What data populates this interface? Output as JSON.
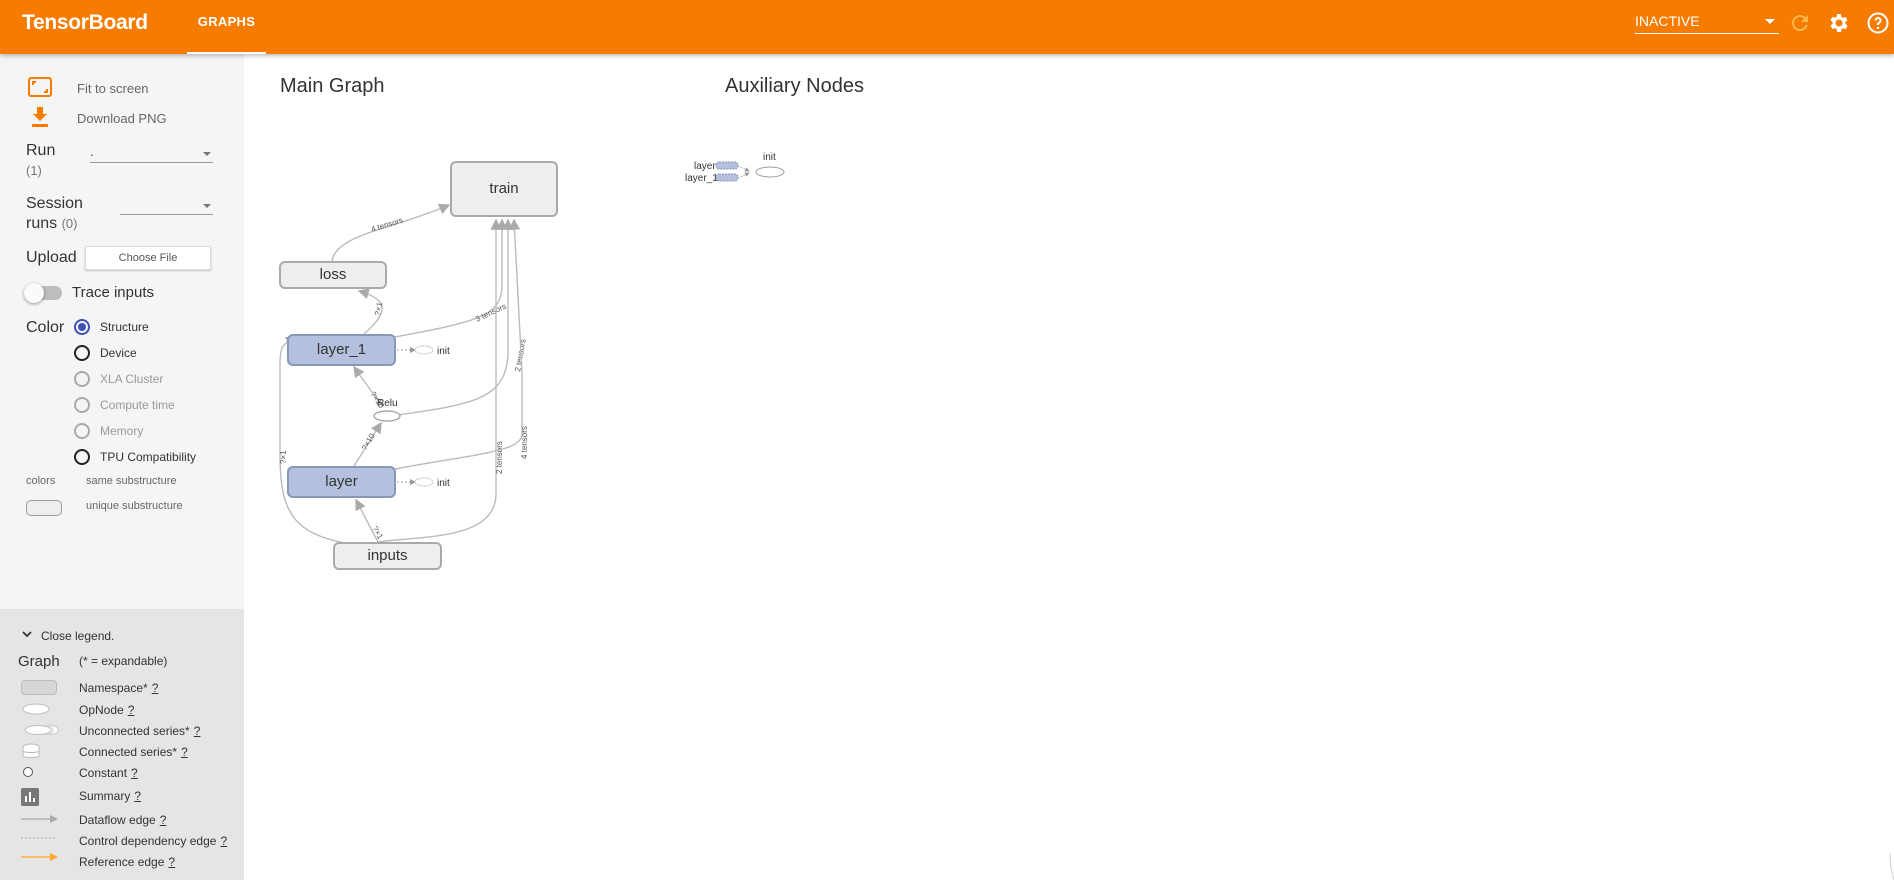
{
  "app": {
    "title": "TensorBoard",
    "tab": "GRAPHS",
    "run_status": "INACTIVE"
  },
  "colors": {
    "accent": "#f57c00",
    "layer_node": "#b4c0de",
    "radio_checked": "#3f51b5"
  },
  "sidebar": {
    "fit_label": "Fit to screen",
    "download_label": "Download PNG",
    "run_label": "Run",
    "run_count": "(1)",
    "run_value": ".",
    "session_label_1": "Session",
    "session_label_2": "runs",
    "session_count": "(0)",
    "upload_label": "Upload",
    "choose_file": "Choose File",
    "trace_label": "Trace inputs",
    "color_label": "Color",
    "color_options": [
      {
        "label": "Structure",
        "checked": true,
        "disabled": false
      },
      {
        "label": "Device",
        "checked": false,
        "disabled": false
      },
      {
        "label": "XLA Cluster",
        "checked": false,
        "disabled": true
      },
      {
        "label": "Compute time",
        "checked": false,
        "disabled": true
      },
      {
        "label": "Memory",
        "checked": false,
        "disabled": true
      },
      {
        "label": "TPU Compatibility",
        "checked": false,
        "disabled": false
      }
    ],
    "colors_label": "colors",
    "same_sub": "same substructure",
    "unique_sub": "unique substructure"
  },
  "legend": {
    "close_label": "Close legend.",
    "graph_label": "Graph",
    "expandable": "(* = expandable)",
    "items": [
      {
        "label": "Namespace*",
        "help": "?"
      },
      {
        "label": "OpNode",
        "help": "?"
      },
      {
        "label": "Unconnected series*",
        "help": "?"
      },
      {
        "label": "Connected series*",
        "help": "?"
      },
      {
        "label": "Constant",
        "help": "?"
      },
      {
        "label": "Summary",
        "help": "?"
      },
      {
        "label": "Dataflow edge",
        "help": "?"
      },
      {
        "label": "Control dependency edge",
        "help": "?"
      },
      {
        "label": "Reference edge",
        "help": "?"
      }
    ]
  },
  "graph": {
    "main_title": "Main Graph",
    "aux_title": "Auxiliary Nodes",
    "nodes": {
      "train": "train",
      "loss": "loss",
      "layer_1": "layer_1",
      "layer": "layer",
      "inputs": "inputs",
      "relu": "Relu",
      "init": "init"
    },
    "edge_labels": {
      "loss_train": "4 tensors",
      "layer1_train": "3 tensors",
      "relu_train": "2 tensors",
      "inputs_train": "2 tensors",
      "layer_train": "4 tensors",
      "layer1_loss": "?×1",
      "relu_layer1": "?×10",
      "layer_relu": "?×10",
      "inputs_layer": "?×1",
      "inputs_loss": "?×1"
    },
    "aux": {
      "layer": "layer",
      "layer_1": "layer_1",
      "init": "init"
    }
  }
}
